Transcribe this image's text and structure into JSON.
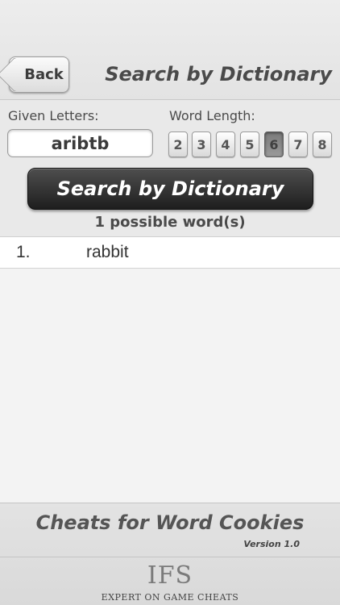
{
  "header": {
    "back_label": "Back",
    "title": "Search by Dictionary"
  },
  "search_form": {
    "given_letters_label": "Given Letters:",
    "given_letters_value": "aribtb",
    "word_length_label": "Word Length:",
    "lengths": [
      "2",
      "3",
      "4",
      "5",
      "6",
      "7",
      "8"
    ],
    "selected_length": "6",
    "search_button_label": "Search by Dictionary"
  },
  "results": {
    "count_text": "1 possible word(s)",
    "items": [
      {
        "index": "1.",
        "word": "rabbit"
      }
    ]
  },
  "footer": {
    "title": "Cheats for Word Cookies",
    "version": "Version 1.0",
    "logo_text": "IFS",
    "logo_tagline": "EXPERT ON GAME CHEATS"
  }
}
